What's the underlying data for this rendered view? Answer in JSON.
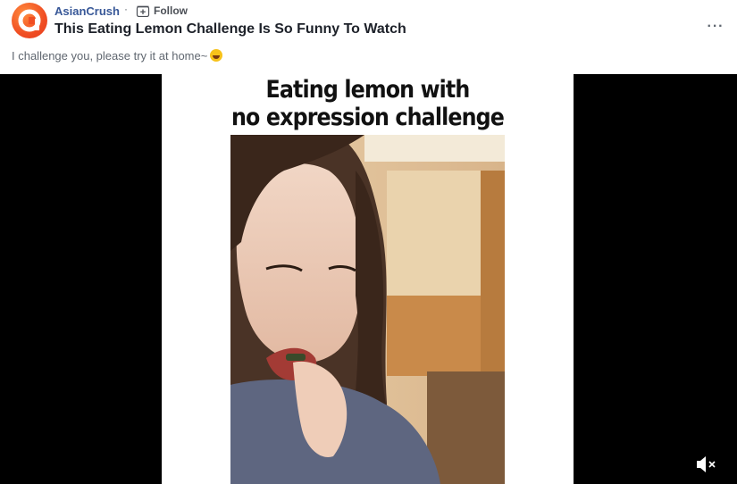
{
  "post": {
    "page_name": "AsianCrush",
    "separator": "·",
    "follow_label": "Follow",
    "title": "This Eating Lemon Challenge Is So Funny To Watch",
    "more_label": "···",
    "caption": "I challenge you, please try it at home~",
    "caption_emoji": "tears-of-joy-emoji"
  },
  "video": {
    "headline_line1": "Eating lemon with",
    "headline_line2": "no expression challenge",
    "muted": true
  },
  "colors": {
    "brand_link": "#385898",
    "avatar_orange": "#f04e23",
    "video_bg": "#000000"
  }
}
